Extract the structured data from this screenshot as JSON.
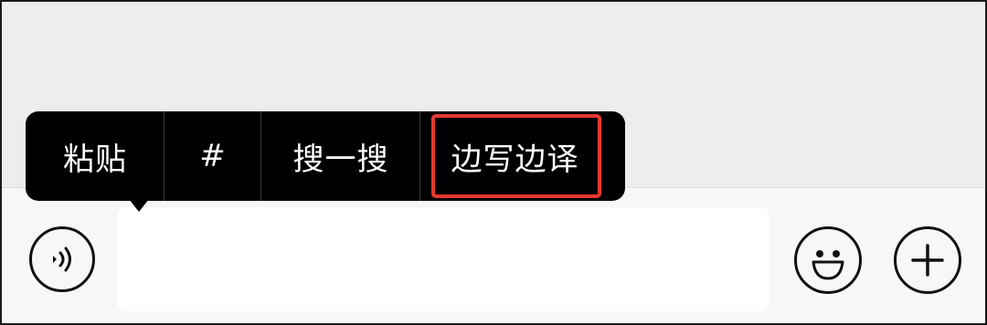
{
  "context_menu": {
    "items": [
      {
        "label": "粘贴"
      },
      {
        "label": "#"
      },
      {
        "label": "搜一搜"
      },
      {
        "label": "边写边译",
        "highlighted": true
      }
    ],
    "highlight_color": "#e5392f"
  },
  "input_bar": {
    "text_value": "",
    "voice_icon": "voice-wave-icon",
    "emoji_icon": "smile-face-icon",
    "more_icon": "plus-icon"
  }
}
